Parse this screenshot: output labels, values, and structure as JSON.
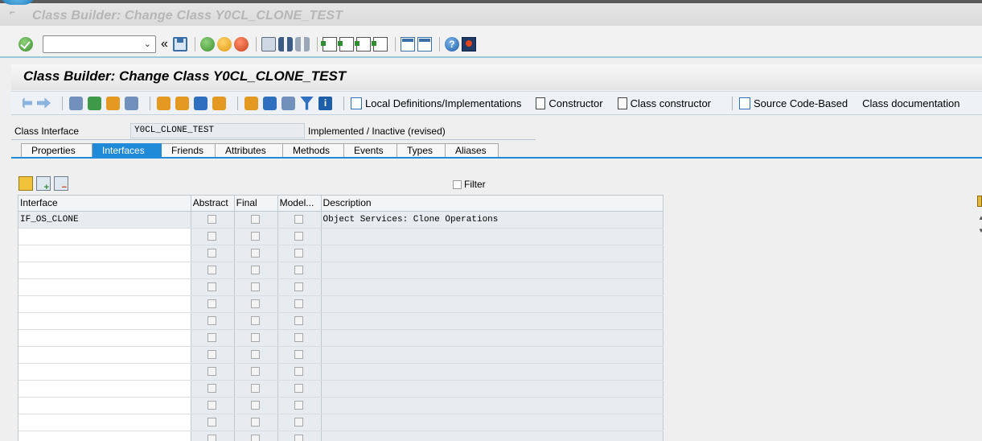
{
  "window": {
    "title": "Class Builder: Change Class Y0CL_CLONE_TEST"
  },
  "system_toolbar": {
    "command_field": {
      "value": "",
      "placeholder": ""
    },
    "back_double": "«",
    "help_glyph": "?"
  },
  "screen_title": "Class Builder: Change Class Y0CL_CLONE_TEST",
  "app_toolbar": {
    "local_definitions": "Local Definitions/Implementations",
    "constructor": "Constructor",
    "class_constructor": "Class constructor",
    "source_code_based": "Source Code-Based",
    "class_documentation": "Class documentation",
    "info_glyph": "i"
  },
  "header": {
    "label": "Class Interface",
    "value": "Y0CL_CLONE_TEST",
    "status": "Implemented / Inactive (revised)"
  },
  "tabs": [
    {
      "label": "Properties",
      "active": false
    },
    {
      "label": "Interfaces",
      "active": true
    },
    {
      "label": "Friends",
      "active": false
    },
    {
      "label": "Attributes",
      "active": false
    },
    {
      "label": "Methods",
      "active": false
    },
    {
      "label": "Events",
      "active": false
    },
    {
      "label": "Types",
      "active": false
    },
    {
      "label": "Aliases",
      "active": false
    }
  ],
  "filter_label": "Filter",
  "table": {
    "columns": [
      "Interface",
      "Abstract",
      "Final",
      "Model...",
      "Description"
    ],
    "rows": [
      {
        "interface": "IF_OS_CLONE",
        "description": "Object Services: Clone Operations"
      }
    ]
  }
}
